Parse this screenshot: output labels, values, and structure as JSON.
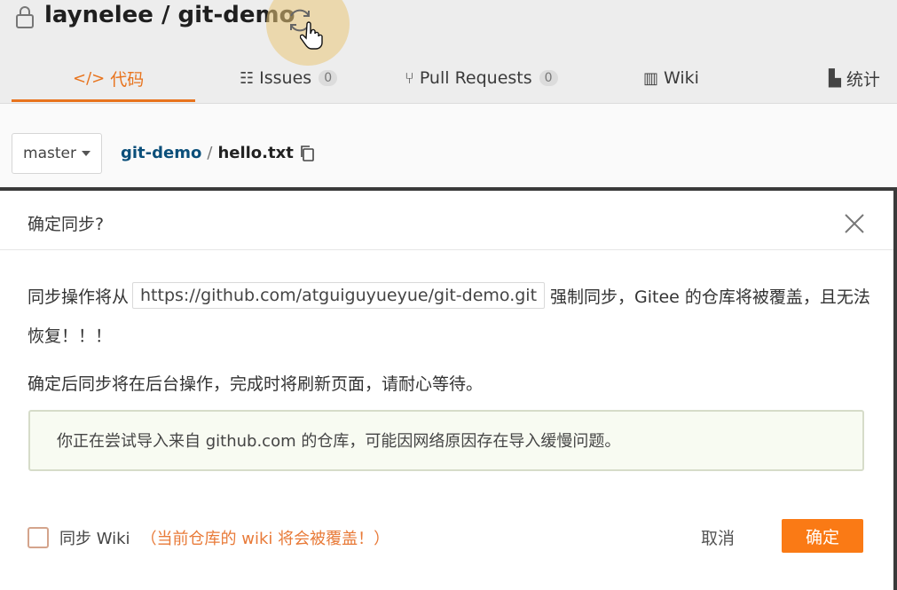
{
  "repo": {
    "title": "laynelee / git-demo",
    "tabs": [
      {
        "label": "代码",
        "icon": "code-icon",
        "active": true
      },
      {
        "label": "Issues",
        "icon": "issues-icon",
        "count": "0"
      },
      {
        "label": "Pull Requests",
        "icon": "pull-request-icon",
        "count": "0"
      },
      {
        "label": "Wiki",
        "icon": "book-icon"
      },
      {
        "label": "统计",
        "icon": "stats-icon"
      }
    ],
    "branch": "master",
    "breadcrumb": {
      "repo": "git-demo",
      "separator": "/",
      "file": "hello.txt"
    }
  },
  "modal": {
    "title": "确定同步?",
    "line1_prefix": "同步操作将从",
    "source_url": "https://github.com/atguiguyueyue/git-demo.git",
    "line1_suffix": "强制同步，Gitee 的仓库将被覆盖，且无法",
    "line2": "恢复！！！",
    "line3": "确定后同步将在后台操作，完成时将刷新页面，请耐心等待。",
    "notice": "你正在尝试导入来自 github.com 的仓库，可能因网络原因存在导入缓慢问题。",
    "wiki_checkbox_label": "同步 Wiki",
    "wiki_warning": "（当前仓库的 wiki 将会被覆盖！）",
    "cancel_label": "取消",
    "confirm_label": "确定"
  },
  "colors": {
    "accent": "#fa7a15",
    "tab_active": "#e8741e",
    "link": "#0b4f7a",
    "notice_bg": "#f8fbf2"
  }
}
